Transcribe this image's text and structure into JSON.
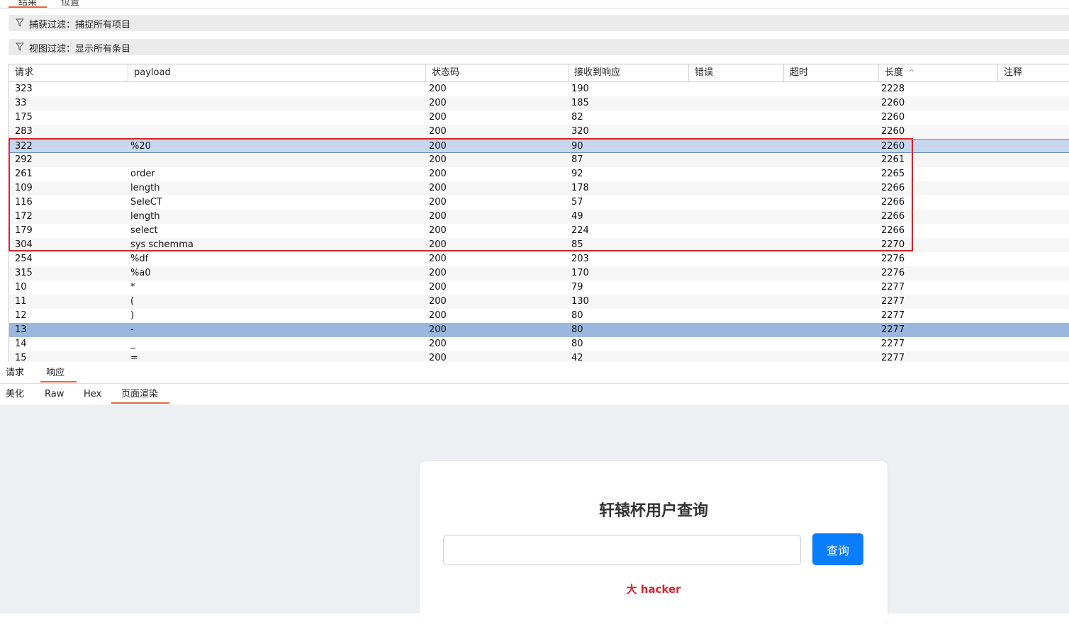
{
  "top_tabs": [
    "结果",
    "位置"
  ],
  "capture_filter": "捕获过滤：捕捉所有项目",
  "view_filter": "视图过滤：显示所有条目",
  "table": {
    "headers": [
      "请求",
      "payload",
      "状态码",
      "接收到响应",
      "错误",
      "超时",
      "长度",
      "注释"
    ],
    "sort_indicator": "^",
    "rows": [
      [
        "323",
        "",
        "200",
        "190",
        "",
        "",
        "2228",
        ""
      ],
      [
        "33",
        "",
        "200",
        "185",
        "",
        "",
        "2260",
        ""
      ],
      [
        "175",
        "",
        "200",
        "82",
        "",
        "",
        "2260",
        ""
      ],
      [
        "283",
        "",
        "200",
        "320",
        "",
        "",
        "2260",
        ""
      ],
      [
        "322",
        "%20",
        "200",
        "90",
        "",
        "",
        "2260",
        ""
      ],
      [
        "292",
        "",
        "200",
        "87",
        "",
        "",
        "2261",
        ""
      ],
      [
        "261",
        "order",
        "200",
        "92",
        "",
        "",
        "2265",
        ""
      ],
      [
        "109",
        "length",
        "200",
        "178",
        "",
        "",
        "2266",
        ""
      ],
      [
        "116",
        "SeleCT",
        "200",
        "57",
        "",
        "",
        "2266",
        ""
      ],
      [
        "172",
        "length",
        "200",
        "49",
        "",
        "",
        "2266",
        ""
      ],
      [
        "179",
        "select",
        "200",
        "224",
        "",
        "",
        "2266",
        ""
      ],
      [
        "304",
        "sys schemma",
        "200",
        "85",
        "",
        "",
        "2270",
        ""
      ],
      [
        "254",
        "%df",
        "200",
        "203",
        "",
        "",
        "2276",
        ""
      ],
      [
        "315",
        "%a0",
        "200",
        "170",
        "",
        "",
        "2276",
        ""
      ],
      [
        "10",
        "*",
        "200",
        "79",
        "",
        "",
        "2277",
        ""
      ],
      [
        "11",
        "(",
        "200",
        "130",
        "",
        "",
        "2277",
        ""
      ],
      [
        "12",
        ")",
        "200",
        "80",
        "",
        "",
        "2277",
        ""
      ],
      [
        "13",
        "-",
        "200",
        "80",
        "",
        "",
        "2277",
        ""
      ],
      [
        "14",
        "_",
        "200",
        "80",
        "",
        "",
        "2277",
        ""
      ],
      [
        "15",
        "=",
        "200",
        "42",
        "",
        "",
        "2277",
        ""
      ]
    ]
  },
  "req_resp_tabs": [
    "请求",
    "响应"
  ],
  "view_tabs": [
    "美化",
    "Raw",
    "Hex",
    "页面渲染"
  ],
  "render": {
    "title": "轩辕杯用户查询",
    "input_value": "",
    "button": "查询",
    "message": "大 hacker"
  },
  "colors": {
    "accent_tab": "#e8663a",
    "highlight_box": "#d9232d",
    "selected_row_light": "#c7d8ee",
    "selected_row_strong": "#9bb7de",
    "button": "#0a7dfc"
  }
}
